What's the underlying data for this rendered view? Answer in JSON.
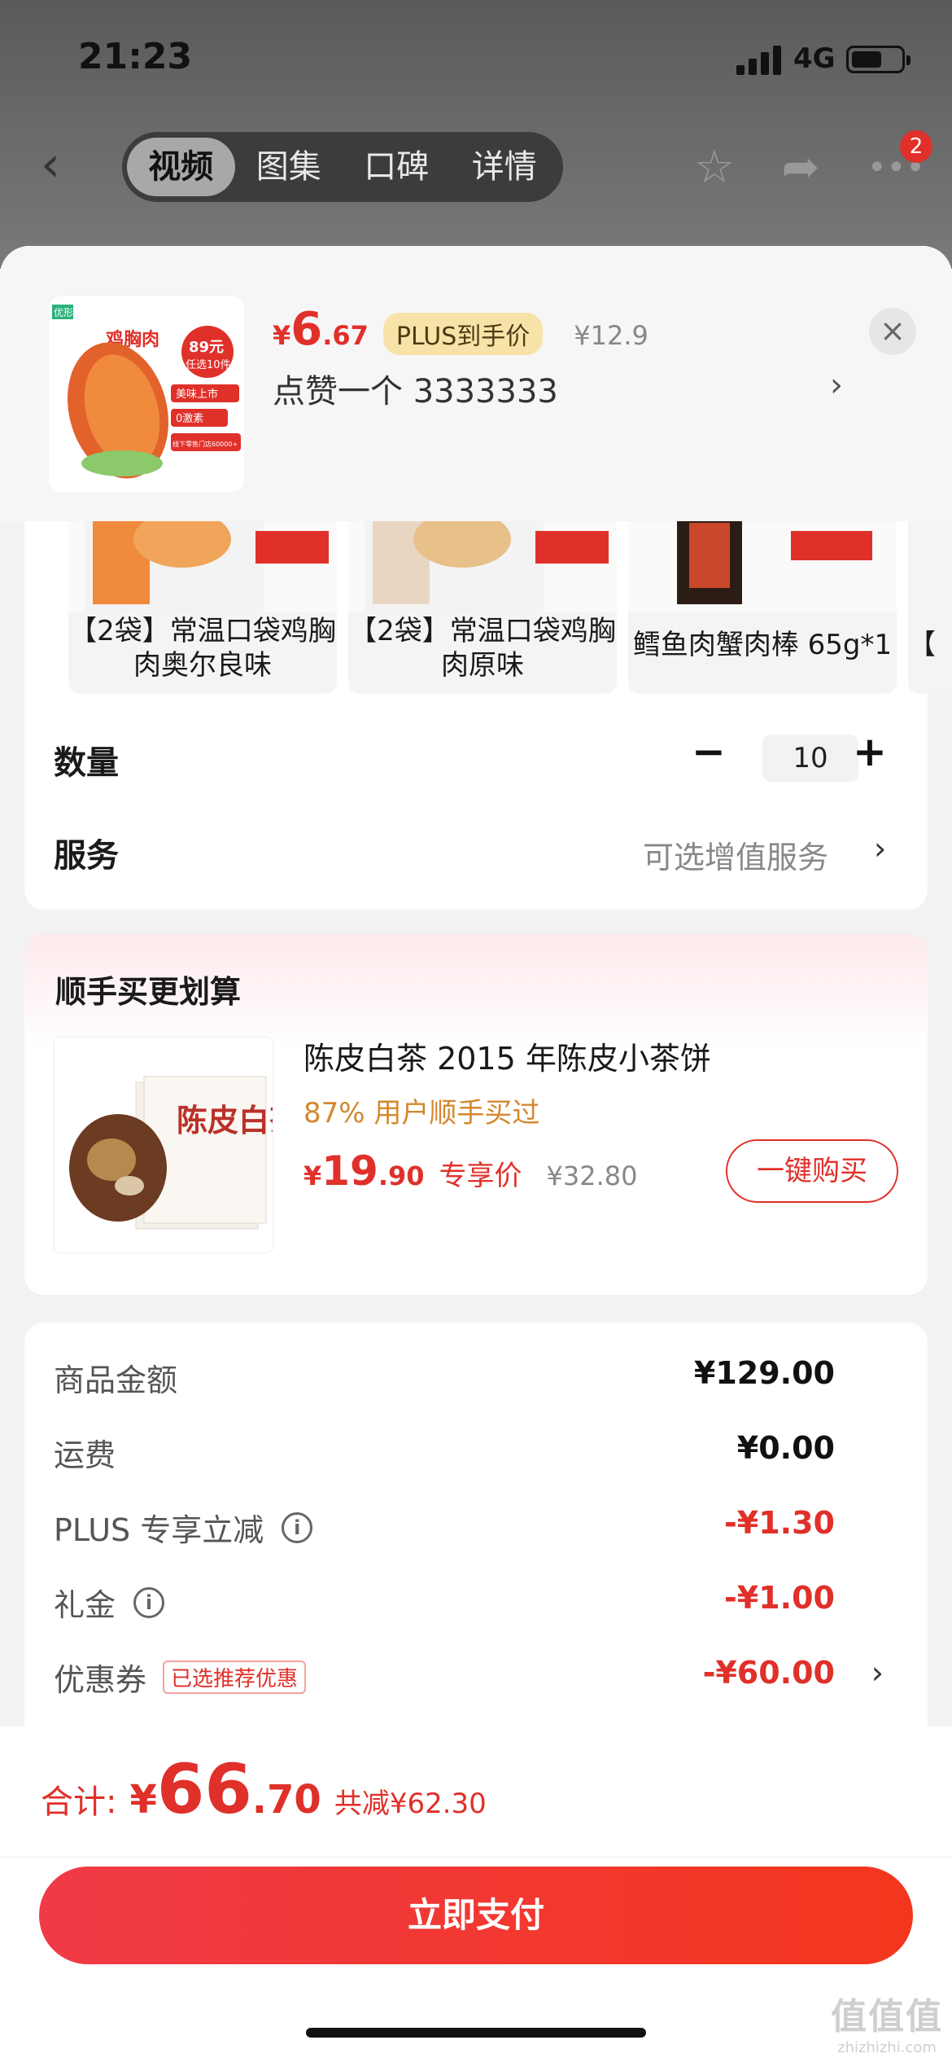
{
  "status_bar": {
    "time": "21:23",
    "network": "4G"
  },
  "nav": {
    "tabs": [
      {
        "label": "视频",
        "active": true
      },
      {
        "label": "图集",
        "active": false
      },
      {
        "label": "口碑",
        "active": false
      },
      {
        "label": "详情",
        "active": false
      }
    ],
    "badge_count": "2",
    "icons": [
      "back-icon",
      "star-icon",
      "share-icon",
      "more-icon"
    ]
  },
  "product": {
    "thumb_text": {
      "brand": "优形",
      "title": "鸡胸肉",
      "promo_price": "89元",
      "promo_text": "任选10件",
      "tag1": "美味上市",
      "tag2": "0激素",
      "tag3": "线下零售门店60000+"
    },
    "price_yen": "¥",
    "price_int": "6",
    "price_dec": ".67",
    "plus_tag": "PLUS到手价",
    "orig_price": "¥12.9",
    "spec": "点赞一个  3333333"
  },
  "variants": [
    {
      "name": "【2袋】常温口袋鸡胸肉奥尔良味"
    },
    {
      "name": "【2袋】常温口袋鸡胸肉原味"
    },
    {
      "name": "鳕鱼肉蟹肉棒 65g*1"
    },
    {
      "name": "【"
    }
  ],
  "quantity": {
    "label": "数量",
    "value": "10",
    "minus": "−",
    "plus": "+"
  },
  "service": {
    "label": "服务",
    "value": "可选增值服务"
  },
  "upsell": {
    "title": "顺手买更划算",
    "name": "陈皮白茶 2015 年陈皮小茶饼",
    "buyers": "87% 用户顺手买过",
    "price_yen": "¥",
    "price_int": "19",
    "price_dec": ".90",
    "price_tag": "专享价",
    "orig_price": "¥32.80",
    "button": "一键购买",
    "image_text": "陈皮白茶"
  },
  "summary": [
    {
      "label": "商品金额",
      "value": "¥129.00",
      "red": false
    },
    {
      "label": "运费",
      "value": "¥0.00",
      "red": false
    },
    {
      "label": "PLUS 专享立减",
      "value": "-¥1.30",
      "red": true,
      "info": true
    },
    {
      "label": "礼金",
      "value": "-¥1.00",
      "red": true,
      "info": true
    },
    {
      "label": "优惠券",
      "value": "-¥60.00",
      "red": true,
      "tag": "已选推荐优惠",
      "chevron": true
    }
  ],
  "footer": {
    "total_label": "合计:",
    "total_yen": "¥",
    "total_int": "66",
    "total_dec": ".70",
    "total_save": "共减¥62.30",
    "pay_button": "立即支付"
  },
  "watermark": {
    "logo": "值值值",
    "url": "zhizhizhi.com"
  },
  "colors": {
    "accent": "#e0302a",
    "plus_tag_bg": "#f7e3a8",
    "upsell_buyers": "#d3882e"
  }
}
